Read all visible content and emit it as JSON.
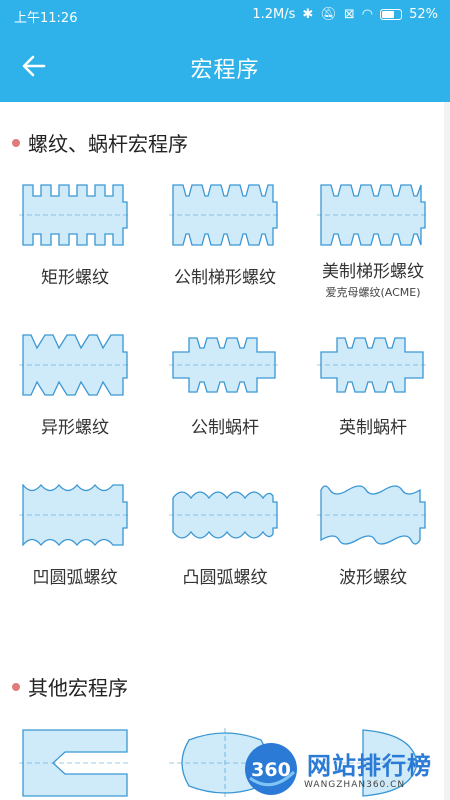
{
  "status_bar": {
    "time": "上午11:26",
    "network_speed": "1.2M/s",
    "battery": "52%"
  },
  "app_bar": {
    "title": "宏程序"
  },
  "sections": [
    {
      "title": "螺纹、蜗杆宏程序",
      "items": [
        {
          "label": "矩形螺纹"
        },
        {
          "label": "公制梯形螺纹"
        },
        {
          "label": "美制梯形螺纹",
          "sub": "爱克母螺纹(ACME)"
        },
        {
          "label": "异形螺纹"
        },
        {
          "label": "公制蜗杆"
        },
        {
          "label": "英制蜗杆"
        },
        {
          "label": "凹圆弧螺纹"
        },
        {
          "label": "凸圆弧螺纹"
        },
        {
          "label": "波形螺纹"
        }
      ]
    },
    {
      "title": "其他宏程序"
    }
  ],
  "watermark": {
    "logo_text": "360",
    "brand": "网站排行榜",
    "url": "WANGZHAN360.CN"
  },
  "colors": {
    "primary": "#2fb2ea",
    "shape_fill": "#cfeaf8",
    "shape_stroke": "#3a97d4",
    "bullet": "#e07b7b"
  }
}
